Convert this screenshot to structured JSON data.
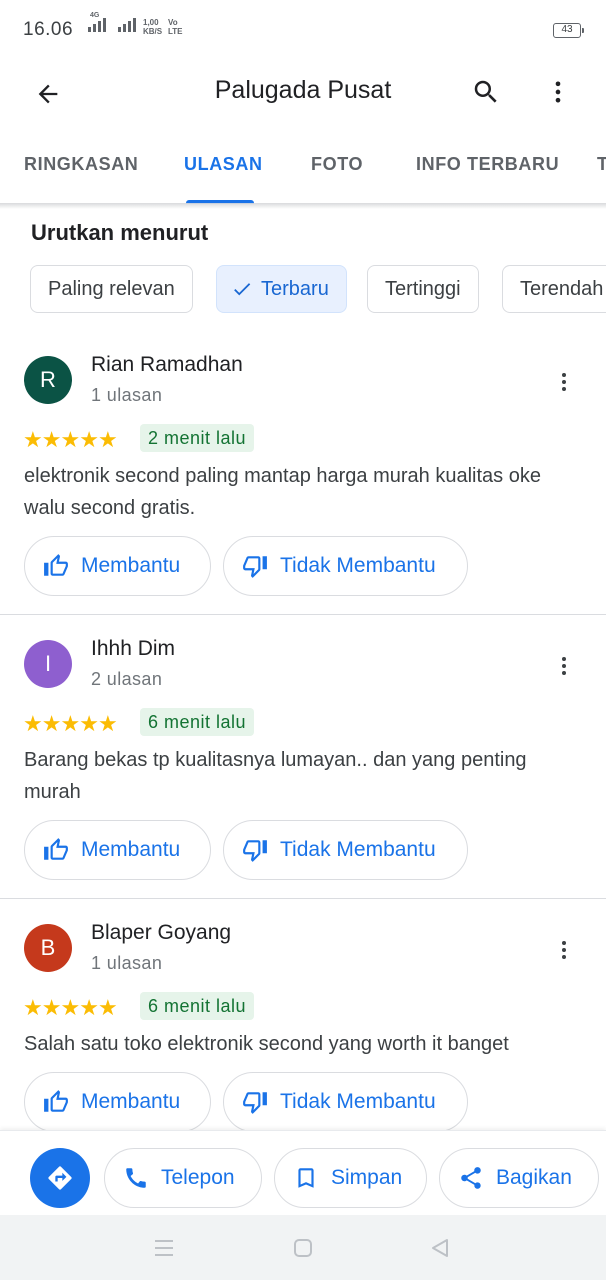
{
  "status_bar": {
    "time": "16.06",
    "network_type": "4G",
    "speed_value": "1,00",
    "speed_unit": "KB/S",
    "volte_top": "Vo",
    "volte_bottom": "LTE",
    "battery": "43"
  },
  "header": {
    "title": "Palugada Pusat",
    "back_icon": "arrow-left-icon",
    "search_icon": "search-icon",
    "more_icon": "more-vert-icon"
  },
  "tabs": [
    {
      "label": "RINGKASAN",
      "active": false
    },
    {
      "label": "ULASAN",
      "active": true
    },
    {
      "label": "FOTO",
      "active": false
    },
    {
      "label": "INFO TERBARU",
      "active": false
    },
    {
      "label": "T",
      "active": false
    }
  ],
  "sort": {
    "title": "Urutkan menurut",
    "chips": [
      {
        "label": "Paling relevan",
        "selected": false
      },
      {
        "label": "Terbaru",
        "selected": true
      },
      {
        "label": "Tertinggi",
        "selected": false
      },
      {
        "label": "Terendah",
        "selected": false
      }
    ]
  },
  "reviews": [
    {
      "initial": "R",
      "avatar_color": "#0b5345",
      "name": "Rian Ramadhan",
      "meta": "1 ulasan",
      "rating": 5,
      "time": "2 menit lalu",
      "text": "elektronik second paling mantap harga murah kualitas oke walu second gratis.",
      "helpful_label": "Membantu",
      "unhelpful_label": "Tidak Membantu"
    },
    {
      "initial": "I",
      "avatar_color": "#8e5fcf",
      "name": "Ihhh Dim",
      "meta": "2 ulasan",
      "rating": 5,
      "time": "6 menit lalu",
      "text": "Barang bekas tp kualitasnya lumayan.. dan yang penting murah",
      "helpful_label": "Membantu",
      "unhelpful_label": "Tidak Membantu"
    },
    {
      "initial": "B",
      "avatar_color": "#c5391c",
      "name": "Blaper Goyang",
      "meta": "1 ulasan",
      "rating": 5,
      "time": "6 menit lalu",
      "text": "Salah satu toko elektronik second yang worth it banget",
      "helpful_label": "Membantu",
      "unhelpful_label": "Tidak Membantu"
    }
  ],
  "bottom_actions": {
    "directions_icon": "directions-icon",
    "call_label": "Telepon",
    "save_label": "Simpan",
    "share_label": "Bagikan"
  },
  "colors": {
    "accent": "#1a73e8",
    "star": "#fbbc04",
    "badge_bg": "#e6f4ea",
    "badge_text": "#137333"
  }
}
